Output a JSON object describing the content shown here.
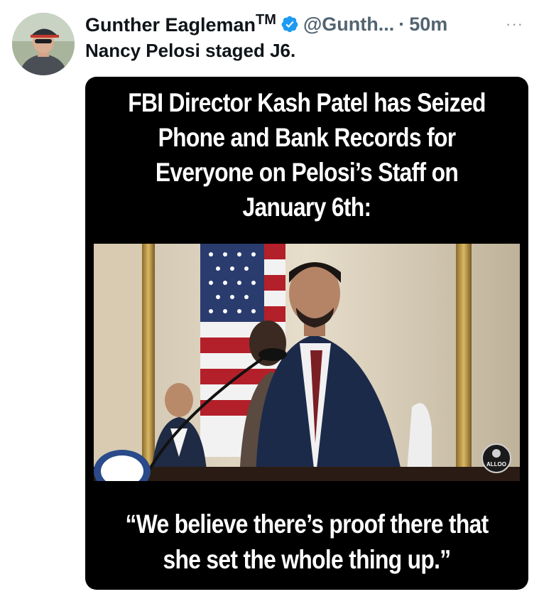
{
  "tweet": {
    "author_name": "Gunther Eagleman",
    "trademark": "TM",
    "handle": "@Gunth...",
    "separator": "·",
    "time": "50m",
    "more_label": "···",
    "text": "Nancy Pelosi staged J6."
  },
  "media": {
    "headline": "FBI Director Kash Patel has Seized Phone and Bank Records for Everyone on Pelosi’s Staff on January 6th:",
    "quote": "“We believe there’s proof there that she set the whole thing up.”",
    "watermark": "ALLOO"
  },
  "colors": {
    "verified_badge": "#1d9bf0",
    "text_primary": "#0f1419",
    "text_secondary": "#536471",
    "card_background": "#000000"
  },
  "icons": {
    "verified": "verified-badge-icon",
    "more": "more-dots-icon"
  }
}
